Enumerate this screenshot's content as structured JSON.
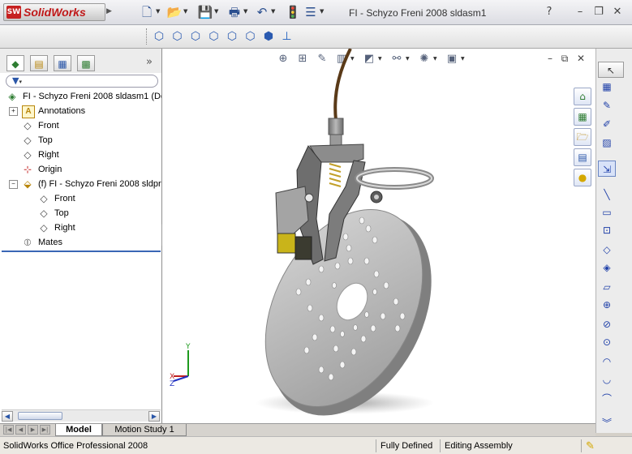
{
  "app": {
    "name": "SolidWorks",
    "logo_mark": "SW"
  },
  "window": {
    "title": "FI - Schyzo Freni 2008 sldasm1",
    "controls": {
      "help": "?",
      "minimize": "–",
      "restore": "❐",
      "close": "✕"
    }
  },
  "quick_access": [
    {
      "name": "new-doc-icon",
      "glyph": "🗋"
    },
    {
      "name": "open-folder-icon",
      "glyph": "📂"
    },
    {
      "name": "save-icon",
      "glyph": "💾"
    },
    {
      "name": "print-icon",
      "glyph": "🖶"
    },
    {
      "name": "undo-icon",
      "glyph": "↶"
    },
    {
      "name": "rebuild-traffic-light-icon",
      "glyph": "🚦"
    },
    {
      "name": "options-icon",
      "glyph": "☰"
    }
  ],
  "view_toolbar": [
    {
      "name": "view-front-icon",
      "glyph": "⬡"
    },
    {
      "name": "view-back-icon",
      "glyph": "⬡"
    },
    {
      "name": "view-left-icon",
      "glyph": "⬡"
    },
    {
      "name": "view-right-icon",
      "glyph": "⬡"
    },
    {
      "name": "view-top-icon",
      "glyph": "⬡"
    },
    {
      "name": "view-bottom-icon",
      "glyph": "⬡"
    },
    {
      "name": "view-isometric-icon",
      "glyph": "⬢"
    },
    {
      "name": "normal-to-icon",
      "glyph": "⊥"
    }
  ],
  "panel": {
    "tabs": [
      {
        "name": "featuremanager-tab-icon",
        "glyph": "◆"
      },
      {
        "name": "propertymanager-tab-icon",
        "glyph": "▤"
      },
      {
        "name": "configurationmanager-tab-icon",
        "glyph": "▦"
      },
      {
        "name": "dimxpert-tab-icon",
        "glyph": "▩"
      }
    ],
    "expand_label": "»",
    "filter_icon": "filter-icon"
  },
  "tree": [
    {
      "id": "root",
      "label": "FI - Schyzo Freni 2008 sldasm1  (De",
      "indent": 0,
      "icon": "assembly-icon",
      "glyph": "◈",
      "color": "#2e7d32",
      "expander": ""
    },
    {
      "id": "annotations",
      "label": "Annotations",
      "indent": 1,
      "icon": "annotations-icon",
      "glyph": "A",
      "color": "#b8860b",
      "expander": "+"
    },
    {
      "id": "front",
      "label": "Front",
      "indent": 1,
      "icon": "plane-icon",
      "glyph": "◇",
      "color": "#444444",
      "expander": ""
    },
    {
      "id": "top",
      "label": "Top",
      "indent": 1,
      "icon": "plane-icon",
      "glyph": "◇",
      "color": "#444444",
      "expander": ""
    },
    {
      "id": "right",
      "label": "Right",
      "indent": 1,
      "icon": "plane-icon",
      "glyph": "◇",
      "color": "#444444",
      "expander": ""
    },
    {
      "id": "origin",
      "label": "Origin",
      "indent": 1,
      "icon": "origin-icon",
      "glyph": "⊹",
      "color": "#c62828",
      "expander": ""
    },
    {
      "id": "part",
      "label": "(f) FI - Schyzo Freni 2008 sldpr",
      "indent": 1,
      "icon": "part-icon",
      "glyph": "⬙",
      "color": "#b8860b",
      "expander": "−"
    },
    {
      "id": "part-front",
      "label": "Front",
      "indent": 2,
      "icon": "plane-icon",
      "glyph": "◇",
      "color": "#444444",
      "expander": ""
    },
    {
      "id": "part-top",
      "label": "Top",
      "indent": 2,
      "icon": "plane-icon",
      "glyph": "◇",
      "color": "#444444",
      "expander": ""
    },
    {
      "id": "part-right",
      "label": "Right",
      "indent": 2,
      "icon": "plane-icon",
      "glyph": "◇",
      "color": "#444444",
      "expander": ""
    },
    {
      "id": "mates",
      "label": "Mates",
      "indent": 1,
      "icon": "mates-icon",
      "glyph": "⦶",
      "color": "#555555",
      "expander": ""
    }
  ],
  "heads_up": [
    {
      "name": "zoom-to-fit-icon",
      "glyph": "⊕"
    },
    {
      "name": "zoom-to-area-icon",
      "glyph": "⊞"
    },
    {
      "name": "previous-view-icon",
      "glyph": "✎"
    },
    {
      "name": "section-view-icon",
      "glyph": "▥",
      "dd": true
    },
    {
      "name": "view-orientation-icon",
      "glyph": "◩",
      "dd": true
    },
    {
      "name": "display-style-icon",
      "glyph": "⚯",
      "dd": true
    },
    {
      "name": "hide-show-items-icon",
      "glyph": "✺",
      "dd": true
    },
    {
      "name": "edit-appearance-icon",
      "glyph": "▣",
      "dd": true
    }
  ],
  "viewport_controls": {
    "minimize": "–",
    "restore": "⧉",
    "close": "✕"
  },
  "task_pane": [
    {
      "name": "resources-home-icon",
      "glyph": "⌂"
    },
    {
      "name": "design-library-icon",
      "glyph": "▦"
    },
    {
      "name": "file-explorer-icon",
      "glyph": "🗁"
    },
    {
      "name": "view-palette-icon",
      "glyph": "▤"
    },
    {
      "name": "appearances-icon",
      "glyph": "●"
    }
  ],
  "right_toolbar": [
    {
      "name": "select-arrow-icon",
      "glyph": "↖"
    },
    {
      "name": "grid-icon",
      "glyph": "▦"
    },
    {
      "name": "sketch-icon",
      "glyph": "✎"
    },
    {
      "name": "3d-sketch-icon",
      "glyph": "✐"
    },
    {
      "name": "sketch-picture-icon",
      "glyph": "▨"
    },
    {
      "name": "smart-dimension-icon",
      "glyph": "⇲"
    },
    {
      "name": "line-icon",
      "glyph": "╲"
    },
    {
      "name": "rectangle-icon",
      "glyph": "▭"
    },
    {
      "name": "center-rectangle-icon",
      "glyph": "⊡"
    },
    {
      "name": "polygon-icon",
      "glyph": "◇"
    },
    {
      "name": "polygon-center-icon",
      "glyph": "◈"
    },
    {
      "name": "parallelogram-icon",
      "glyph": "▱"
    },
    {
      "name": "circle-icon",
      "glyph": "⊕"
    },
    {
      "name": "perimeter-circle-icon",
      "glyph": "⊘"
    },
    {
      "name": "circle-center-icon",
      "glyph": "⊙"
    },
    {
      "name": "arc-icon",
      "glyph": "◠"
    },
    {
      "name": "tangent-arc-icon",
      "glyph": "◡"
    },
    {
      "name": "three-point-arc-icon",
      "glyph": "⌒"
    },
    {
      "name": "more-tools-chevron-icon",
      "glyph": "︾"
    }
  ],
  "bottom_tabs": {
    "model": "Model",
    "motion": "Motion Study 1"
  },
  "status": {
    "product": "SolidWorks Office Professional 2008",
    "state": "Fully Defined",
    "mode": "Editing Assembly",
    "help_icon": "balloon-help-icon"
  },
  "triad": {
    "x": "X",
    "y": "Y",
    "z": "Z"
  },
  "colors": {
    "accent": "#3a66b5",
    "logo": "#c01818",
    "selection_bg": "#316ac5"
  }
}
